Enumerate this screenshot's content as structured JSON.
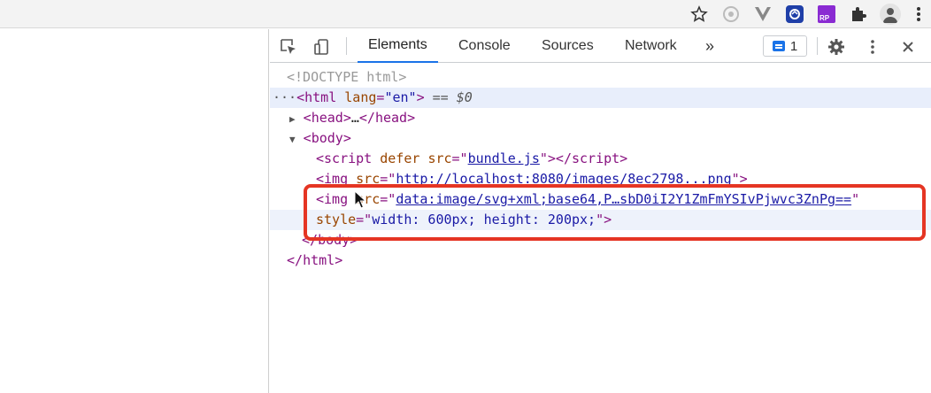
{
  "browser": {
    "icons": [
      "star-icon",
      "chrome-cast-icon",
      "vue-devtools-icon",
      "extension-icon",
      "rp-extension-icon",
      "puzzle-icon",
      "profile-avatar-icon",
      "more-vertical-icon"
    ],
    "rp_label": "RP"
  },
  "devtools": {
    "tabs": [
      {
        "label": "Elements",
        "active": true
      },
      {
        "label": "Console",
        "active": false
      },
      {
        "label": "Sources",
        "active": false
      },
      {
        "label": "Network",
        "active": false
      }
    ],
    "more_tabs": "»",
    "issues_count": "1",
    "accent": "#1a73e8"
  },
  "code": {
    "doctype": "<!DOCTYPE html>",
    "html_open_dots": "···",
    "html_tag": "html",
    "html_attr": "lang",
    "html_attr_val": "\"en\"",
    "selected_marker": "== $0",
    "head": "head",
    "head_ellipsis": "…",
    "body": "body",
    "script_attr_defer": "defer",
    "script_attr_src": "src",
    "script_src_val": "bundle.js",
    "img1_src_val": "http://localhost:8080/images/8ec2798...png",
    "img2_src_val": "data:image/svg+xml;base64,P…sbD0iI2Y1ZmFmYSIvPjwvc3ZnPg==",
    "img2_style_attr": "style",
    "img2_style_val": "width: 600px; height: 200px;",
    "body_close": "body",
    "html_close": "html"
  },
  "highlight_color": "#e53523"
}
